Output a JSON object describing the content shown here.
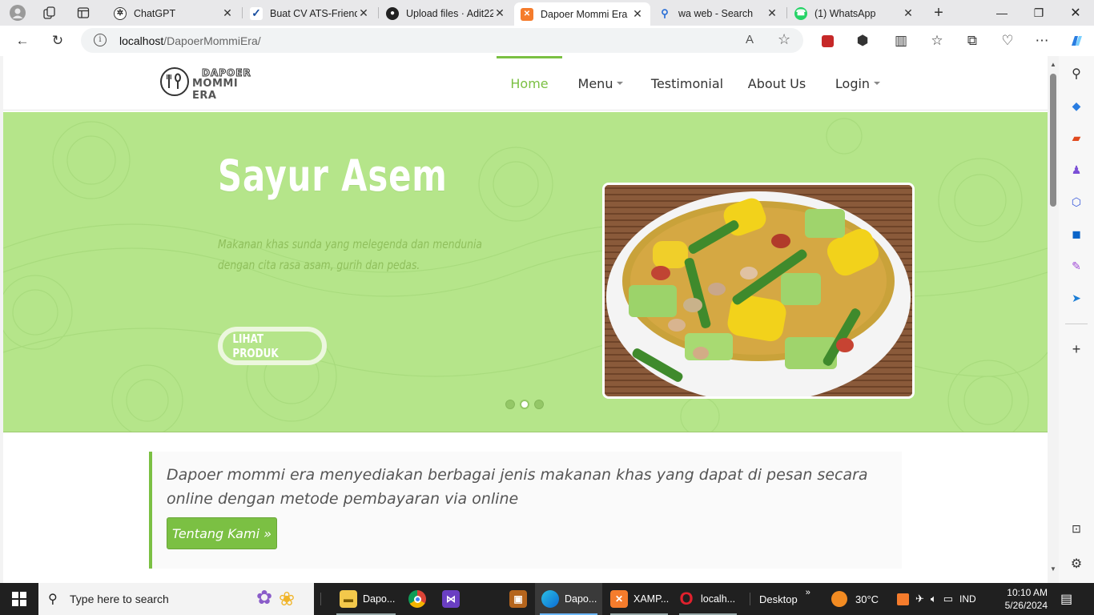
{
  "browser": {
    "tabs": [
      {
        "title": "ChatGPT",
        "icon": "chatgpt-icon"
      },
      {
        "title": "Buat CV ATS-Friendl",
        "icon": "cv-site-icon"
      },
      {
        "title": "Upload files · Adit22",
        "icon": "github-icon"
      },
      {
        "title": "Dapoer Mommi Era",
        "icon": "xampp-icon",
        "active": true
      },
      {
        "title": "wa web - Search",
        "icon": "bing-search-icon"
      },
      {
        "title": "(1) WhatsApp",
        "icon": "whatsapp-icon"
      }
    ],
    "address": {
      "host": "localhost",
      "path": "/DapoerMommiEra/"
    }
  },
  "site": {
    "logo": {
      "line1": "DAPOER",
      "line2": "MOMMI ERA"
    },
    "nav": [
      {
        "label": "Home",
        "active": true
      },
      {
        "label": "Menu",
        "dropdown": true
      },
      {
        "label": "Testimonial"
      },
      {
        "label": "About Us"
      },
      {
        "label": "Login",
        "dropdown": true
      }
    ],
    "hero": {
      "title": "Sayur Asem",
      "description": "Makanan khas sunda yang melegenda dan mendunia dengan cita rasa asam, gurih dan pedas.",
      "button": "LIHAT PRODUK",
      "slides": 3,
      "active_slide": 2
    },
    "about": {
      "text": "Dapoer mommi era menyediakan berbagai jenis makanan khas yang dapat di pesan secara online dengan metode pembayaran via online",
      "button": "Tentang Kami »"
    }
  },
  "taskbar": {
    "search_placeholder": "Type here to search",
    "apps": [
      {
        "label": "Dapo...",
        "icon": "file-explorer-icon"
      },
      {
        "label": "",
        "icon": "chrome-icon"
      },
      {
        "label": "",
        "icon": "visual-studio-icon"
      },
      {
        "label": "",
        "icon": "photo-app-icon"
      },
      {
        "label": "Dapo...",
        "icon": "edge-icon",
        "active": true
      },
      {
        "label": "XAMP...",
        "icon": "xampp-icon"
      },
      {
        "label": "localh...",
        "icon": "opera-icon"
      }
    ],
    "desktop": "Desktop",
    "weather": "30°C",
    "lang": "IND",
    "time": "10:10 AM",
    "date": "5/26/2024"
  },
  "colors": {
    "accent": "#7bc043",
    "hero_bg": "#b5e58a"
  }
}
